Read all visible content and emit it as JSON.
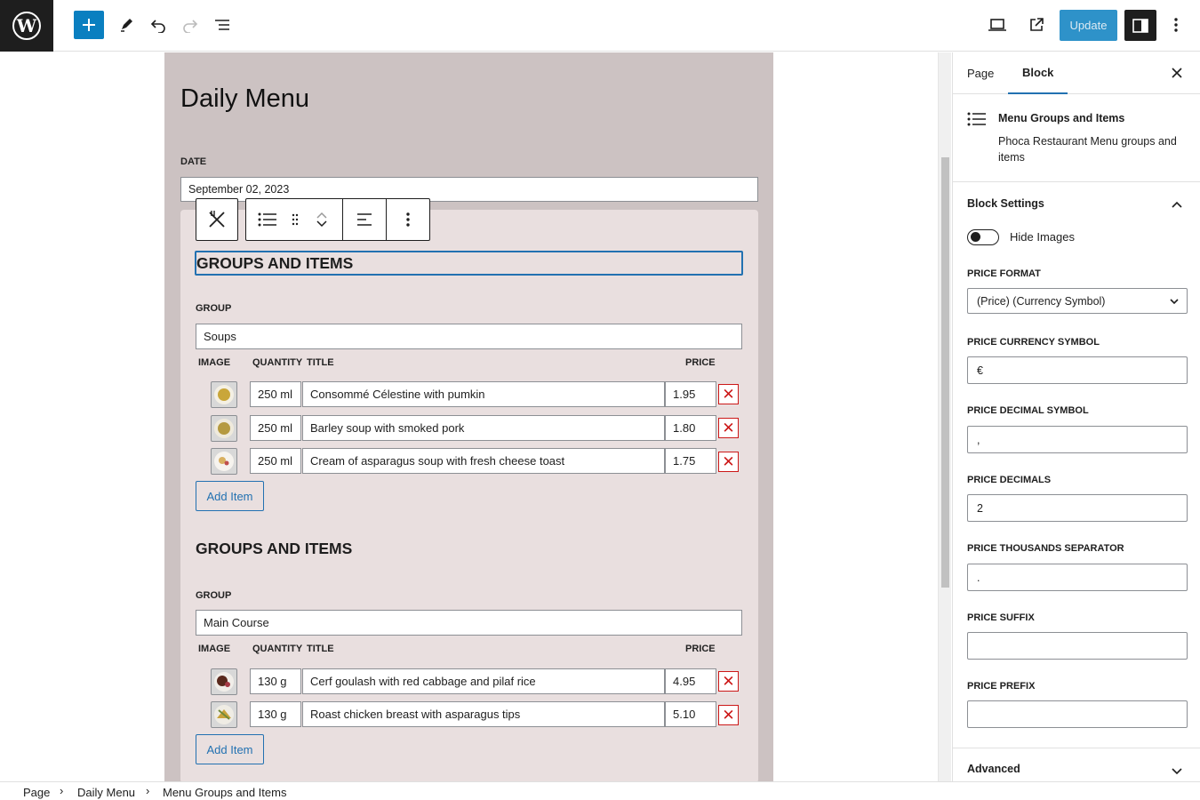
{
  "header": {
    "update_label": "Update"
  },
  "icons": [
    "wordpress-logo",
    "plus-icon",
    "pencil-icon",
    "undo-icon",
    "redo-icon",
    "list-view-icon",
    "desktop-icon",
    "external-link-icon",
    "sidebar-icon",
    "more-vertical-icon",
    "fork-knife-icon",
    "list-icon",
    "drag-icon",
    "chevron-up-icon",
    "chevron-down-icon",
    "align-icon",
    "close-icon",
    "chevron-right-icon"
  ],
  "colors": {
    "accent": "#0a7fc0",
    "page_bg": "#ccc2c2",
    "block_bg": "#e9dfdf",
    "delete": "#cc1818"
  },
  "editor": {
    "page_title": "Daily Menu",
    "date_label": "DATE",
    "date_value": "September 02, 2023",
    "groups": [
      {
        "heading": "GROUPS AND ITEMS",
        "group_label": "GROUP",
        "group_value": "Soups",
        "columns": [
          "IMAGE",
          "QUANTITY",
          "TITLE",
          "PRICE"
        ],
        "items": [
          {
            "quantity": "250 ml",
            "title": "Consommé Célestine with pumkin",
            "price": "1.95"
          },
          {
            "quantity": "250 ml",
            "title": "Barley soup with smoked pork",
            "price": "1.80"
          },
          {
            "quantity": "250 ml",
            "title": "Cream of asparagus soup with fresh cheese toast",
            "price": "1.75"
          }
        ],
        "add_label": "Add Item"
      },
      {
        "heading": "GROUPS AND ITEMS",
        "group_label": "GROUP",
        "group_value": "Main Course",
        "columns": [
          "IMAGE",
          "QUANTITY",
          "TITLE",
          "PRICE"
        ],
        "items": [
          {
            "quantity": "130 g",
            "title": "Cerf goulash with red cabbage and pilaf rice",
            "price": "4.95"
          },
          {
            "quantity": "130 g",
            "title": "Roast chicken breast with asparagus tips",
            "price": "5.10"
          }
        ],
        "add_label": "Add Item"
      }
    ]
  },
  "sidebar": {
    "tabs": [
      "Page",
      "Block"
    ],
    "active_tab": "Block",
    "block_title": "Menu Groups and Items",
    "block_desc": "Phoca Restaurant Menu groups and items",
    "settings_title": "Block Settings",
    "hide_images_label": "Hide Images",
    "hide_images_on": false,
    "price_format_label": "PRICE FORMAT",
    "price_format_value": "(Price) (Currency Symbol)",
    "currency_label": "PRICE CURRENCY SYMBOL",
    "currency_value": "€",
    "decimal_symbol_label": "PRICE DECIMAL SYMBOL",
    "decimal_symbol_value": ",",
    "decimals_label": "PRICE DECIMALS",
    "decimals_value": "2",
    "thousands_label": "PRICE THOUSANDS SEPARATOR",
    "thousands_value": ".",
    "suffix_label": "PRICE SUFFIX",
    "suffix_value": "",
    "prefix_label": "PRICE PREFIX",
    "prefix_value": "",
    "advanced_title": "Advanced"
  },
  "breadcrumb": [
    "Page",
    "Daily Menu",
    "Menu Groups and Items"
  ]
}
